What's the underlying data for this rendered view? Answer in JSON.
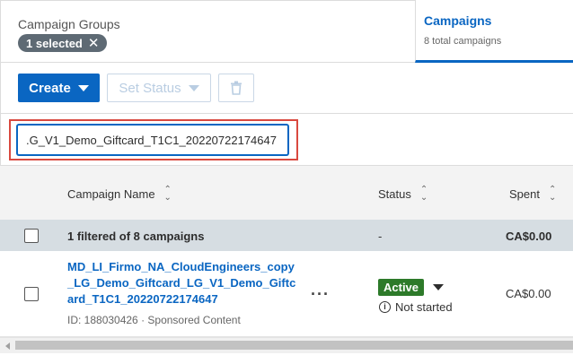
{
  "header": {
    "campaign_groups_title": "Campaign Groups",
    "selected_chip": "1 selected",
    "campaigns_tab": {
      "label": "Campaigns",
      "subtitle": "8 total campaigns"
    }
  },
  "toolbar": {
    "create_label": "Create",
    "set_status_label": "Set Status",
    "delete_icon": "trash-icon"
  },
  "search": {
    "value": ".G_V1_Demo_Giftcard_T1C1_20220722174647"
  },
  "table": {
    "columns": {
      "name": "Campaign Name",
      "status": "Status",
      "spent": "Spent"
    },
    "summary": {
      "text": "1 filtered of 8 campaigns",
      "status": "-",
      "spent": "CA$0.00"
    },
    "rows": [
      {
        "name": "MD_LI_Firmo_NA_CloudEngineers_copy_LG_Demo_Giftcard_LG_V1_Demo_Giftcard_T1C1_20220722174647",
        "meta": "ID: 188030426 · Sponsored Content",
        "more_label": "···",
        "status_badge": "Active",
        "status_note": "Not started",
        "spent": "CA$0.00"
      }
    ]
  },
  "colors": {
    "accent": "#0a66c2",
    "active_badge": "#2d7a2a",
    "highlight_box": "#d9493f"
  }
}
